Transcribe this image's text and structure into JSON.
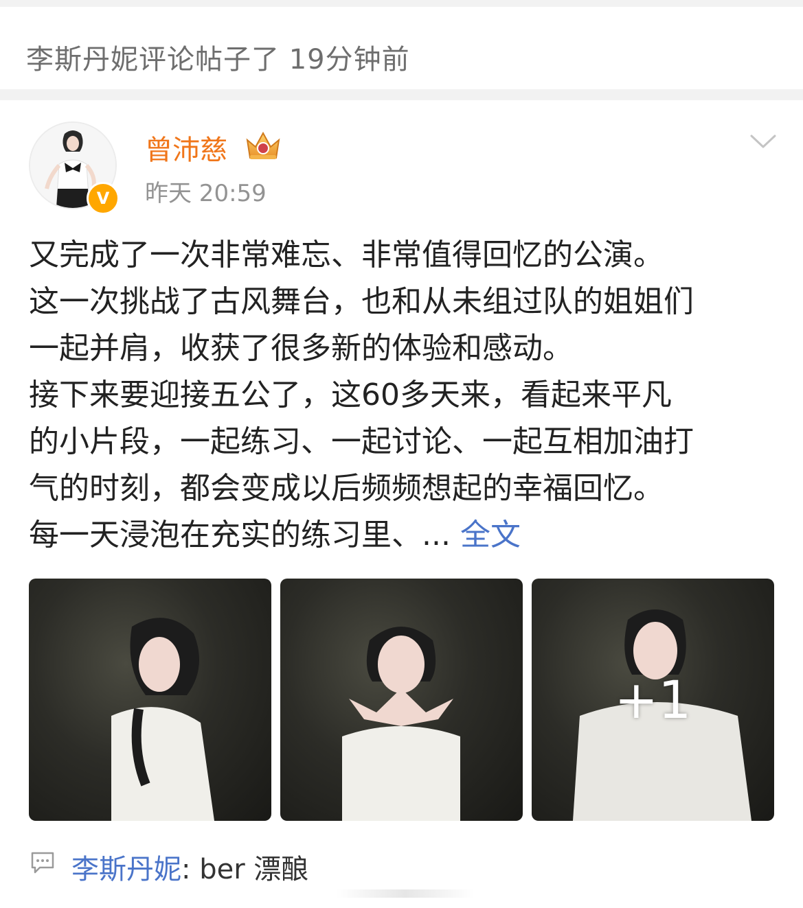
{
  "notification": {
    "text": "李斯丹妮评论帖子了 19分钟前"
  },
  "post": {
    "username": "曾沛慈",
    "verified_badge": "V",
    "timestamp": "昨天 20:59",
    "content_lines": [
      "又完成了一次非常难忘、非常值得回忆的公演。",
      "这一次挑战了古风舞台，也和从未组过队的姐姐们",
      "一起并肩，收获了很多新的体验和感动。",
      "接下来要迎接五公了，这60多天来，看起来平凡",
      "的小片段，一起练习、一起讨论、一起互相加油打",
      "气的时刻，都会变成以后频频想起的幸福回忆。"
    ],
    "truncated_line": "每一天浸泡在充实的练习里、...",
    "full_text_link": "全文",
    "images_more_label": "+1"
  },
  "comment": {
    "user": "李斯丹妮",
    "text": ": ber 漂酿"
  },
  "colors": {
    "username": "#f0761a",
    "link": "#4a74c9",
    "muted": "#939393",
    "badge": "#ffa700"
  },
  "icons": [
    "crown-icon",
    "chevron-down-icon",
    "comment-icon",
    "verified-icon"
  ]
}
